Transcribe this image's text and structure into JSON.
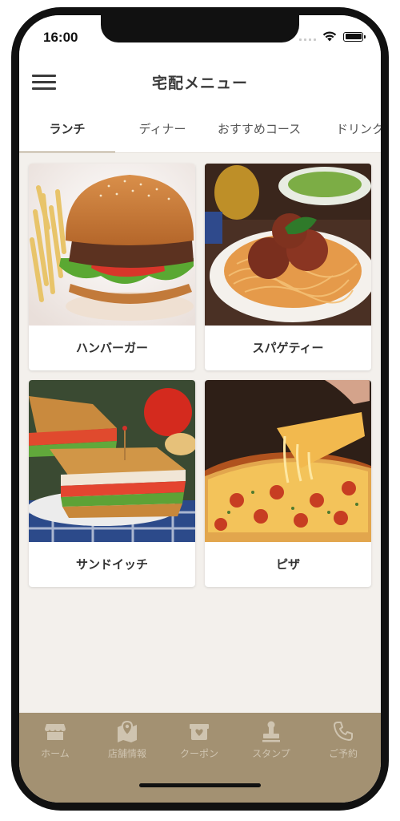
{
  "status_bar": {
    "time": "16:00"
  },
  "header": {
    "title": "宅配メニュー"
  },
  "tabs": [
    {
      "label": "ランチ",
      "active": true
    },
    {
      "label": "ディナー",
      "active": false
    },
    {
      "label": "おすすめコース",
      "active": false
    },
    {
      "label": "ドリンク",
      "active": false
    }
  ],
  "menu_items": [
    {
      "label": "ハンバーガー",
      "image": "hamburger"
    },
    {
      "label": "スパゲティー",
      "image": "spaghetti-meatballs"
    },
    {
      "label": "サンドイッチ",
      "image": "club-sandwich"
    },
    {
      "label": "ピザ",
      "image": "pepperoni-pizza"
    }
  ],
  "bottom_nav": [
    {
      "label": "ホーム",
      "icon": "shop-icon"
    },
    {
      "label": "店舗情報",
      "icon": "map-pin-icon"
    },
    {
      "label": "クーポン",
      "icon": "coupon-icon"
    },
    {
      "label": "スタンプ",
      "icon": "stamp-icon"
    },
    {
      "label": "ご予約",
      "icon": "phone-icon"
    }
  ],
  "colors": {
    "accent": "#a39172",
    "background": "#f3f0ec",
    "nav_label": "#cfc4b0",
    "text": "#333333"
  }
}
